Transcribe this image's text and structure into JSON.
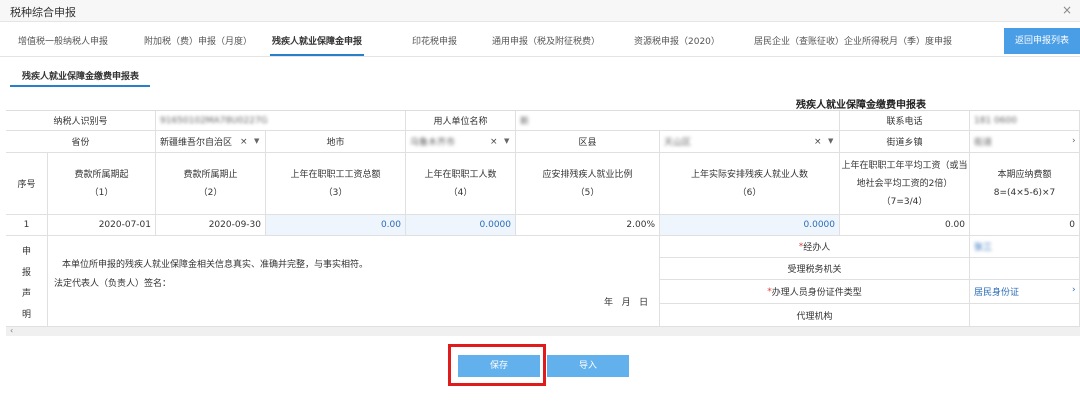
{
  "window": {
    "title": "税种综合申报",
    "close_glyph": "×"
  },
  "tabs": [
    {
      "label": "增值税一般纳税人申报"
    },
    {
      "label": "附加税（费）申报（月度）"
    },
    {
      "label": "残疾人就业保障金申报"
    },
    {
      "label": "印花税申报"
    },
    {
      "label": "通用申报（税及附征税费）"
    },
    {
      "label": "资源税申报（2020）"
    },
    {
      "label": "居民企业（查账征收）企业所得税月（季）度申报"
    }
  ],
  "return_button": "返回申报列表",
  "subtab": "残疾人就业保障金缴费申报表",
  "form": {
    "title": "残疾人就业保障金缴费申报表",
    "row1": {
      "taxpayer_id_label": "纳税人识别号",
      "taxpayer_id_value": "91650102MA78U0227G",
      "employer_name_label": "用人单位名称",
      "employer_name_value": "新",
      "phone_label": "联系电话",
      "phone_value": "181 0600"
    },
    "row2": {
      "province_label": "省份",
      "province_value": "新疆维吾尔自治区",
      "city_label": "地市",
      "city_value": "乌鲁木齐市",
      "district_label": "区县",
      "district_value": "天山区",
      "street_label": "街道乡镇",
      "street_value": "街道",
      "clear_glyph": "×",
      "dropdown_glyph": "▼"
    },
    "header": {
      "seq": "序号",
      "col1": {
        "label": "费款所属期起",
        "idx": "（1）"
      },
      "col2": {
        "label": "费款所属期止",
        "idx": "（2）"
      },
      "col3": {
        "label": "上年在职职工工资总额",
        "idx": "（3）"
      },
      "col4": {
        "label": "上年在职职工人数",
        "idx": "（4）"
      },
      "col5": {
        "label": "应安排残疾人就业比例",
        "idx": "（5）"
      },
      "col6": {
        "label": "上年实际安排残疾人就业人数",
        "idx": "（6）"
      },
      "col7": {
        "line1": "上年在职职工年平均工资（或当",
        "line2": "地社会平均工资的2倍）",
        "idx": "（7=3/4）"
      },
      "col8": {
        "line1": "本期应纳费额",
        "line2": "8=(4×5-6)×7"
      }
    },
    "data_row": {
      "seq": "1",
      "start": "2020-07-01",
      "end": "2020-09-30",
      "wage_total": "0.00",
      "staff_count": "0.0000",
      "ratio": "2.00%",
      "disabled_count": "0.0000",
      "avg_wage": "0.00",
      "payable": "0"
    },
    "declaration": {
      "side_chars": [
        "申",
        "报",
        "声",
        "明"
      ],
      "statement": "本单位所申报的残疾人就业保障金相关信息真实、准确并完整，与事实相符。",
      "signature": "法定代表人（负责人）签名：",
      "date": "年   月   日"
    },
    "right_panel": {
      "required_mark": "*",
      "handler_label": "经办人",
      "handler_value": "张三",
      "tax_office_label": "受理税务机关",
      "id_type_label": "办理人员身份证件类型",
      "id_type_value": "居民身份证",
      "agency_label": "代理机构",
      "arrow_glyph": "›"
    }
  },
  "scroll_left_glyph": "‹",
  "buttons": {
    "save": "保存",
    "import": "导入"
  },
  "colors": {
    "accent": "#2a80c8",
    "button": "#62b0ec",
    "highlight": "#e01b1b"
  }
}
